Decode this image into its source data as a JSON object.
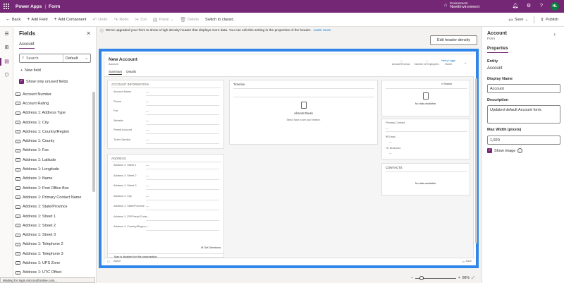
{
  "topbar": {
    "app_name": "Power Apps",
    "separator": "|",
    "section": "Form",
    "env_label": "Environment",
    "env_value": "NewEnvironment",
    "avatar_initials": "HL"
  },
  "commands": {
    "back": "Back",
    "add_field": "Add Field",
    "add_component": "Add Component",
    "undo": "Undo",
    "redo": "Redo",
    "cut": "Cut",
    "paste": "Paste",
    "delete": "Delete",
    "switch_classic": "Switch to classic",
    "save": "Save",
    "publish": "Publish"
  },
  "fields_pane": {
    "title": "Fields",
    "tab": "Account",
    "search_placeholder": "Search",
    "filter_value": "Default",
    "new_field": "New field",
    "show_unused": "Show only unused fields",
    "items": [
      "Account Number",
      "Account Rating",
      "Address 1: Address Type",
      "Address 1: City",
      "Address 1: Country/Region",
      "Address 1: County",
      "Address 1: Fax",
      "Address 1: Latitude",
      "Address 1: Longitude",
      "Address 1: Name",
      "Address 1: Post Office Box",
      "Address 1: Primary Contact Name",
      "Address 1: State/Province",
      "Address 1: Street 1",
      "Address 1: Street 2",
      "Address 1: Street 3",
      "Address 1: Telephone 2",
      "Address 1: Telephone 3",
      "Address 1: UPS Zone",
      "Address 1: UTC Offset"
    ]
  },
  "canvas": {
    "banner": "We've upgraded your form to show a high density header that displays more data. You can edit this setting in the properties of the header.",
    "banner_link": "Learn more",
    "edit_header_button": "Edit header density",
    "zoom_level": "86%"
  },
  "form": {
    "title": "New Account",
    "subtitle": "Account",
    "tabs": [
      "Summary",
      "Details"
    ],
    "header_fields": [
      {
        "value": "---",
        "label": "Annual Revenue"
      },
      {
        "value": "---",
        "label": "Number of Employees"
      },
      {
        "value": "Henry Legge",
        "label": "Owner"
      }
    ],
    "account_info": {
      "heading": "ACCOUNT INFORMATION",
      "rows": [
        {
          "label": "Account Name",
          "value": "---"
        },
        {
          "label": "Phone",
          "value": "---"
        },
        {
          "label": "Fax",
          "value": "---"
        },
        {
          "label": "Website",
          "value": "---"
        },
        {
          "label": "Parent Account",
          "value": "---"
        },
        {
          "label": "Ticker Symbol",
          "value": "---"
        }
      ]
    },
    "address": {
      "heading": "ADDRESS",
      "rows": [
        {
          "label": "Address 1: Street 1",
          "value": "---"
        },
        {
          "label": "Address 1: Street 2",
          "value": "---"
        },
        {
          "label": "Address 1: Street 3",
          "value": "---"
        },
        {
          "label": "Address 1: City",
          "value": "---"
        },
        {
          "label": "Address 1: State/Province",
          "value": "---"
        },
        {
          "label": "Address 1: ZIP/Postal Code",
          "value": "---"
        },
        {
          "label": "Address 1: Country/Region",
          "value": "---"
        }
      ],
      "directions": "Get Directions",
      "map_note": "Map is disabled for this organization."
    },
    "timeline": {
      "heading": "Timeline",
      "empty_title": "Almost there",
      "empty_sub": "Select Save to see your timeline."
    },
    "search_label": "Search",
    "no_data": "No data available.",
    "primary_contact": {
      "heading": "Primary Contact",
      "value": "---",
      "email_label": "Email",
      "email_value": "---",
      "business_label": "Business",
      "business_value": "---"
    },
    "contacts_heading": "CONTACTS",
    "no_data_2": "No data available.",
    "status_left": "Active",
    "status_right": "Save"
  },
  "props": {
    "title": "Account",
    "subtitle": "Form",
    "tab": "Properties",
    "entity_label": "Entity",
    "entity_value": "Account",
    "display_name_label": "Display Name",
    "display_name_value": "Account",
    "description_label": "Description",
    "description_value": "Updated default Account form.",
    "max_width_label": "Max Width (pixels)",
    "max_width_value": "1,920",
    "show_image": "Show image"
  },
  "status_tooltip": "Waiting for login.microsoftonline.com..."
}
